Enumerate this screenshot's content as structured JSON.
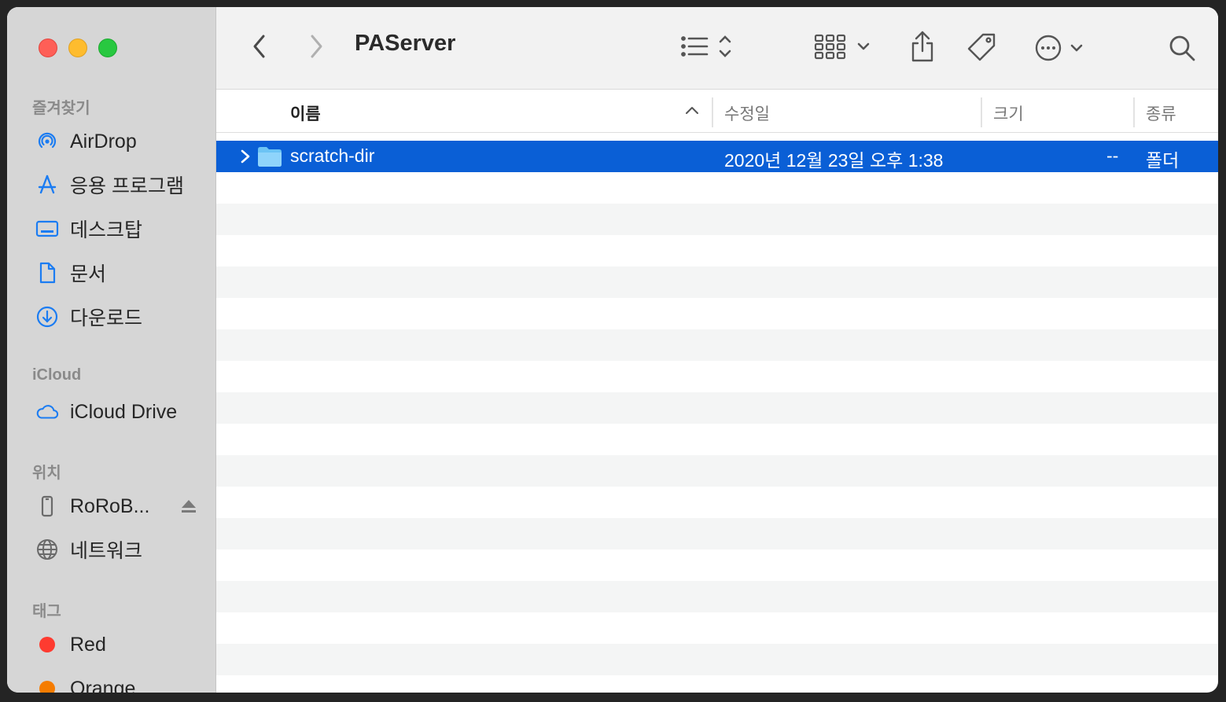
{
  "window": {
    "title": "PAServer"
  },
  "sidebar": {
    "favorites_header": "즐겨찾기",
    "favorites": [
      {
        "label": "AirDrop",
        "icon": "airdrop-icon"
      },
      {
        "label": "응용 프로그램",
        "icon": "applications-icon"
      },
      {
        "label": "데스크탑",
        "icon": "desktop-icon"
      },
      {
        "label": "문서",
        "icon": "document-icon"
      },
      {
        "label": "다운로드",
        "icon": "download-icon"
      }
    ],
    "icloud_header": "iCloud",
    "icloud": [
      {
        "label": "iCloud Drive",
        "icon": "cloud-icon"
      }
    ],
    "locations_header": "위치",
    "locations": [
      {
        "label": "RoRoB...",
        "icon": "phone-icon"
      },
      {
        "label": "네트워크",
        "icon": "globe-icon"
      }
    ],
    "tags_header": "태그",
    "tags": [
      {
        "label": "Red",
        "color": "#fe3b30"
      },
      {
        "label": "Orange",
        "color": "#f57c00"
      }
    ]
  },
  "columns": {
    "name": "이름",
    "modified": "수정일",
    "size": "크기",
    "kind": "종류"
  },
  "files": [
    {
      "name": "scratch-dir",
      "modified": "2020년 12월 23일 오후 1:38",
      "size": "--",
      "kind": "폴더",
      "selected": true
    }
  ],
  "colors": {
    "selection": "#0a5fd6",
    "accent": "#1b7cf2"
  }
}
